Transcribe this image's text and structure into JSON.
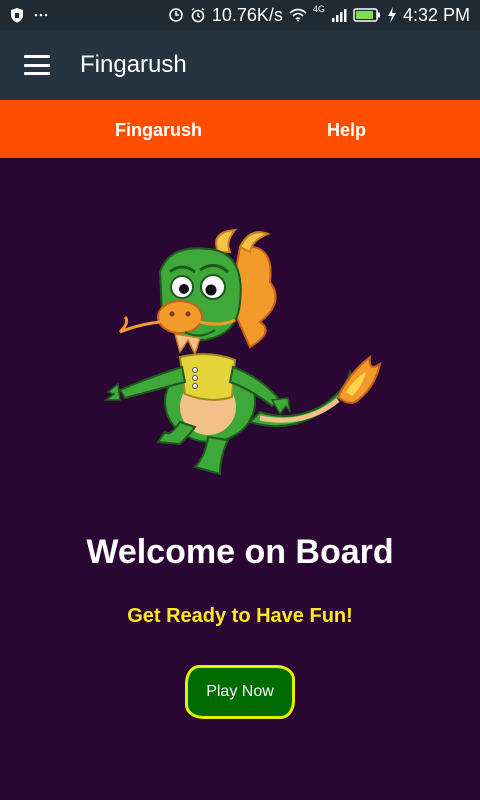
{
  "status_bar": {
    "speed": "10.76K/s",
    "network": "4G",
    "time": "4:32 PM",
    "icons": [
      "shield-icon",
      "more-dots-icon",
      "sync-icon",
      "alarm-icon",
      "wifi-icon",
      "signal-icon",
      "battery-icon",
      "charging-icon"
    ]
  },
  "toolbar": {
    "title": "Fingarush"
  },
  "tabs": [
    {
      "label": "Fingarush"
    },
    {
      "label": "Help"
    }
  ],
  "main": {
    "headline": "Welcome on Board",
    "subtitle": "Get Ready to Have Fun!",
    "play_button": "Play Now"
  },
  "colors": {
    "status_bar_bg": "#1f2a33",
    "toolbar_bg": "#263340",
    "tabbar_bg": "#ff4d00",
    "page_bg": "#2a0833",
    "subtitle": "#ffe81f",
    "button_bg": "#006b00",
    "button_border": "#e4f000"
  }
}
